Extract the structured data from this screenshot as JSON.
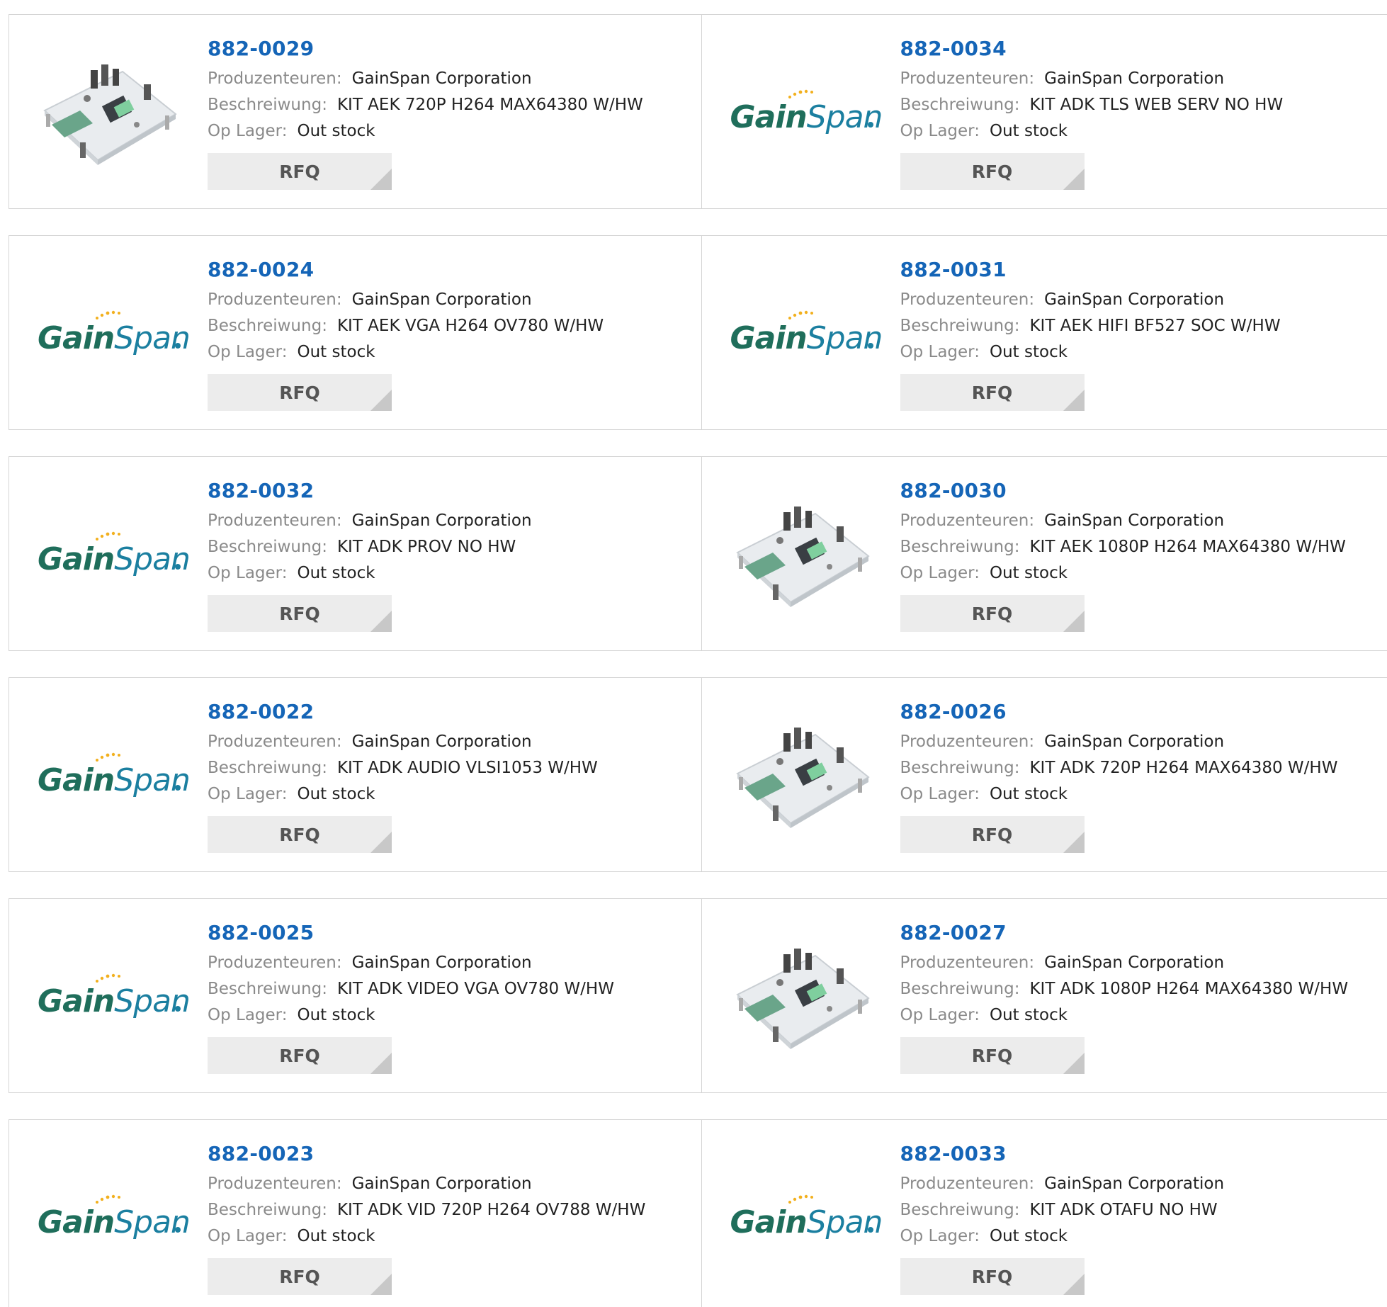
{
  "labels": {
    "manufacturer": "Produzenteuren:",
    "description": "Beschreiwung:",
    "stock": "Op Lager:",
    "rfq": "RFQ"
  },
  "colors": {
    "part_number": "#1565b7",
    "label": "#8a8a8a",
    "value": "#222222",
    "button_bg": "#ececec",
    "border": "#d4d4d4",
    "logo_gain": "#1f6e5b",
    "logo_span": "#1b7fa0",
    "logo_dots": "#f2b01e"
  },
  "logo": {
    "gain": "Gain",
    "span": "Span"
  },
  "products": [
    {
      "part": "882-0029",
      "manufacturer": "GainSpan Corporation",
      "description": "KIT AEK 720P H264 MAX64380 W/HW",
      "stock": "Out stock",
      "image": "board-photo"
    },
    {
      "part": "882-0034",
      "manufacturer": "GainSpan Corporation",
      "description": "KIT ADK TLS WEB SERV NO HW",
      "stock": "Out stock",
      "image": "gainspan-logo"
    },
    {
      "part": "882-0024",
      "manufacturer": "GainSpan Corporation",
      "description": "KIT AEK VGA H264 OV780 W/HW",
      "stock": "Out stock",
      "image": "gainspan-logo"
    },
    {
      "part": "882-0031",
      "manufacturer": "GainSpan Corporation",
      "description": "KIT AEK HIFI BF527 SOC W/HW",
      "stock": "Out stock",
      "image": "gainspan-logo"
    },
    {
      "part": "882-0032",
      "manufacturer": "GainSpan Corporation",
      "description": "KIT ADK PROV NO HW",
      "stock": "Out stock",
      "image": "gainspan-logo"
    },
    {
      "part": "882-0030",
      "manufacturer": "GainSpan Corporation",
      "description": "KIT AEK 1080P H264 MAX64380 W/HW",
      "stock": "Out stock",
      "image": "board-photo"
    },
    {
      "part": "882-0022",
      "manufacturer": "GainSpan Corporation",
      "description": "KIT ADK AUDIO VLSI1053 W/HW",
      "stock": "Out stock",
      "image": "gainspan-logo"
    },
    {
      "part": "882-0026",
      "manufacturer": "GainSpan Corporation",
      "description": "KIT ADK 720P H264 MAX64380 W/HW",
      "stock": "Out stock",
      "image": "board-photo"
    },
    {
      "part": "882-0025",
      "manufacturer": "GainSpan Corporation",
      "description": "KIT ADK VIDEO VGA OV780 W/HW",
      "stock": "Out stock",
      "image": "gainspan-logo"
    },
    {
      "part": "882-0027",
      "manufacturer": "GainSpan Corporation",
      "description": "KIT ADK 1080P H264 MAX64380 W/HW",
      "stock": "Out stock",
      "image": "board-photo"
    },
    {
      "part": "882-0023",
      "manufacturer": "GainSpan Corporation",
      "description": "KIT ADK VID 720P H264 OV788 W/HW",
      "stock": "Out stock",
      "image": "gainspan-logo"
    },
    {
      "part": "882-0033",
      "manufacturer": "GainSpan Corporation",
      "description": "KIT ADK OTAFU NO HW",
      "stock": "Out stock",
      "image": "gainspan-logo"
    }
  ]
}
